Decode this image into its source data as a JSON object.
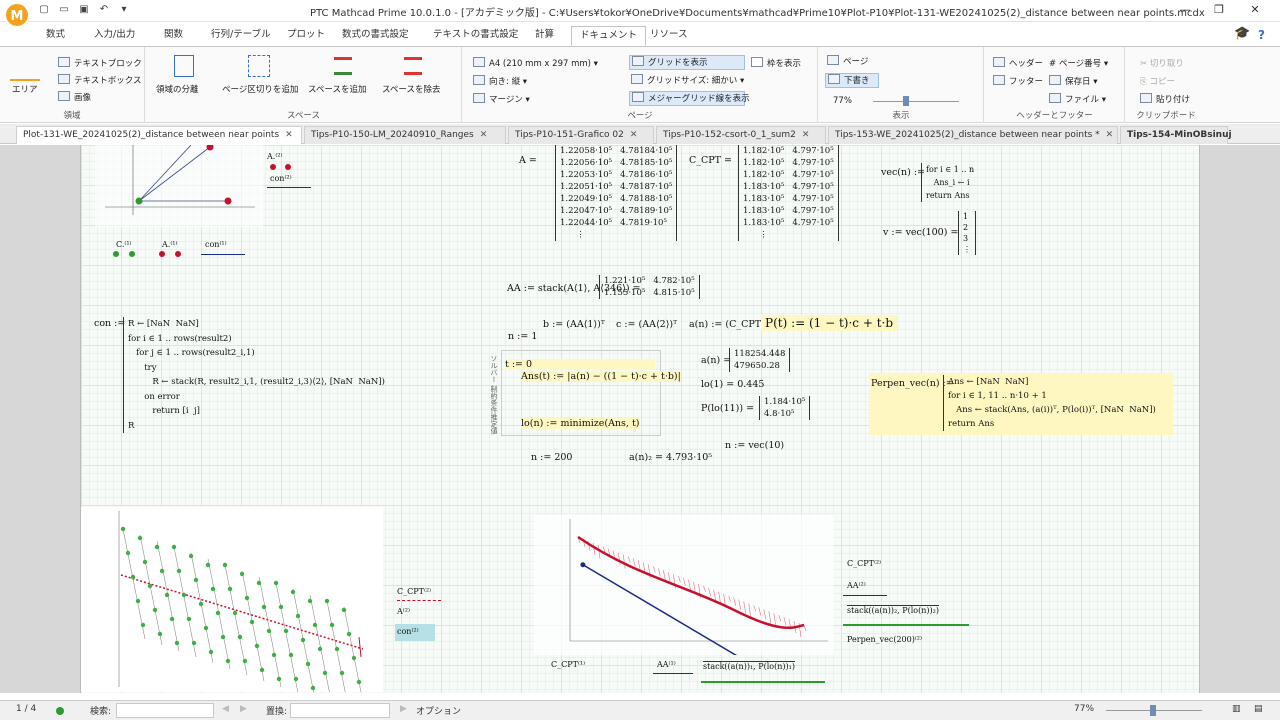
{
  "window": {
    "title": "PTC Mathcad Prime 10.0.1.0 - [アカデミック版] - C:¥Users¥tokor¥OneDrive¥Documents¥mathcad¥Prime10¥Plot-P10¥Plot-131-WE20241025(2)_distance between near points.mcdx",
    "logo_letter": "M",
    "minimize": "—",
    "maximize": "❐",
    "close": "✕"
  },
  "menu": {
    "tabs": [
      "数式",
      "入力/出力",
      "関数",
      "行列/テーブル",
      "プロット",
      "数式の書式設定",
      "テキストの書式設定",
      "計算",
      "ドキュメント",
      "リソース"
    ],
    "active_index": 8
  },
  "ribbon": {
    "groups": {
      "area": {
        "label": "領域",
        "items": [
          "エリア",
          "テキストブロック",
          "テキストボックス",
          "画像"
        ]
      },
      "space": {
        "label": "スペース",
        "items": [
          "領域の分離",
          "ページ区切りを追加",
          "スペースを追加",
          "スペースを除去"
        ]
      },
      "page": {
        "label": "ページ",
        "items": [
          "A4 (210 mm x 297 mm)",
          "向き: 縦",
          "マージン",
          "グリッドを表示",
          "グリッドサイズ: 細かい",
          "メジャーグリッド線を表示",
          "枠を表示"
        ]
      },
      "view": {
        "label": "表示",
        "items": [
          "ページ",
          "下書き"
        ],
        "zoom": "77%"
      },
      "header": {
        "label": "ヘッダーとフッター",
        "items": [
          "ヘッダー",
          "フッター",
          "ページ番号",
          "保存日",
          "ファイル"
        ]
      },
      "clipboard": {
        "label": "クリップボード",
        "items": [
          "切り取り",
          "コピー",
          "貼り付け"
        ]
      }
    }
  },
  "doc_tabs": [
    {
      "label": "Plot-131-WE_20241025(2)_distance between near points",
      "active": true
    },
    {
      "label": "Tips-P10-150-LM_20240910_Ranges",
      "active": false
    },
    {
      "label": "Tips-P10-151-Grafico 02",
      "active": false
    },
    {
      "label": "Tips-P10-152-csort-0_1_sum2",
      "active": false
    },
    {
      "label": "Tips-153-WE_20241025(2)_distance between near points *",
      "active": false
    },
    {
      "label": "Tips-154-MinOBsinuj",
      "active": false
    }
  ],
  "math": {
    "A_label": "A =",
    "A_matrix": "1.22058·10⁵   4.78184·10⁵\n1.22056·10⁵   4.78185·10⁵\n1.22053·10⁵   4.78186·10⁵\n1.22051·10⁵   4.78187·10⁵\n1.22049·10⁵   4.78188·10⁵\n1.22047·10⁵   4.78189·10⁵\n1.22044·10⁵   4.7819·10⁵\n      ⋮",
    "ccpt_label": "C_CPT =",
    "ccpt_matrix": "1.182·10⁵   4.797·10⁵\n1.182·10⁵   4.797·10⁵\n1.182·10⁵   4.797·10⁵\n1.183·10⁵   4.797·10⁵\n1.183·10⁵   4.797·10⁵\n1.183·10⁵   4.797·10⁵\n1.183·10⁵   4.797·10⁵\n      ⋮",
    "vec_def": "vec(n) :=",
    "vec_prog": "for i ∈ 1 .. n\n   Ans_i ← i\nreturn Ans",
    "v_eval": "v := vec(100) =",
    "v_vec": "1\n2\n3\n⋮",
    "AA_def": "AA := stack(A⟨1⟩, A⟨346⟩) =",
    "AA_matrix": "1.221·10⁵   4.782·10⁵\n1.155·10⁵   4.815·10⁵",
    "b_def": "b := (AA⟨1⟩)ᵀ",
    "c_def": "c := (AA⟨2⟩)ᵀ",
    "a_def": "a(n) := (C_CPT⟨n⟩)ᵀ",
    "P_def": "P(t) := (1 − t)·c + t·b",
    "n1": "n := 1",
    "solve_label": "ソルバー 制約条件推定値",
    "t0": "t := 0",
    "ans_def": "Ans(t) := |a(n) − ((1 − t)·c + t·b)|",
    "lo_def": "lo(n) := minimize(Ans, t)",
    "an_eval": "a(n) =",
    "an_vec": "118254.448\n479650.28",
    "lo1": "lo(1) = 0.445",
    "plo11": "P(lo(11)) =",
    "plo11_vec": "1.184·10⁵\n4.8·10⁵",
    "n_vec10": "n := vec(10)",
    "n200": "n := 200",
    "an2": "a(n)₂ = 4.793·10⁵",
    "con_def": "con :=",
    "con_prog": "R ← [NaN  NaN]\nfor i ∈ 1 .. rows(result2)\n   for j ∈ 1 .. rows(result2_i,1)\n      try\n         R ← stack(R, result2_i,1, (result2_i,3)⟨2⟩, [NaN  NaN])\n      on error\n         return [i  j]\nR",
    "perp_def": "Perpen_vec(n) :=",
    "perp_prog": "Ans ← [NaN  NaN]\nfor i ∈ 1, 11 .. n·10 + 1\n   Ans ← stack(Ans, (a(i))ᵀ, P(lo(i))ᵀ, [NaN  NaN])\nreturn Ans"
  },
  "plot_legends": {
    "top_left": [
      "A.⁽²⁾",
      "con⁽²⁾",
      "C.⁽¹⁾",
      "A.⁽¹⁾",
      "con⁽¹⁾"
    ],
    "bottom_left": [
      "C_CPT⁽²⁾",
      "A⁽²⁾",
      "con⁽²⁾"
    ],
    "bottom_right": [
      "C_CPT⁽²⁾",
      "AA⁽²⁾",
      "stack((a(n))₂, P(lo(n))₂)",
      "Perpen_vec(200)⁽²⁾"
    ],
    "bottom_center": [
      "C_CPT⁽¹⁾",
      "AA⁽¹⁾",
      "stack((a(n))₁, P(lo(n))₁)"
    ]
  },
  "chart_data": {
    "type": "line",
    "xlim": [
      115000,
      125000
    ],
    "ylim": [
      479000,
      483000
    ],
    "series": [
      {
        "name": "AA",
        "x": [
          122100,
          115500
        ],
        "y": [
          478200,
          481500
        ]
      }
    ]
  },
  "status": {
    "page": "1 / 4",
    "search_label": "検索:",
    "replace_label": "置換:",
    "options": "オプション",
    "zoom": "77%"
  },
  "colors": {
    "accent": "#2b579a",
    "yellow_region": "#fff7c2",
    "plot_red": "#c8102e",
    "plot_green": "#2e9b2e",
    "plot_navy": "#1a2a8a"
  }
}
